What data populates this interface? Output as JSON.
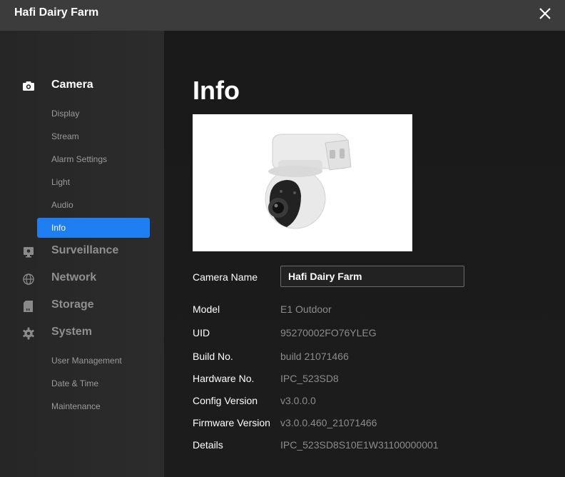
{
  "window": {
    "title": "Hafi Dairy Farm"
  },
  "sidebar": {
    "camera": {
      "label": "Camera",
      "items": [
        "Display",
        "Stream",
        "Alarm Settings",
        "Light",
        "Audio"
      ],
      "active": "Info"
    },
    "surveillance": {
      "label": "Surveillance"
    },
    "network": {
      "label": "Network"
    },
    "storage": {
      "label": "Storage"
    },
    "system": {
      "label": "System",
      "items": [
        "User Management",
        "Date & Time",
        "Maintenance"
      ]
    }
  },
  "main": {
    "title": "Info",
    "camera_name": {
      "label": "Camera Name",
      "value": "Hafi Dairy Farm"
    },
    "rows": [
      {
        "label": "Model",
        "value": "E1 Outdoor"
      },
      {
        "label": "UID",
        "value": "95270002FO76YLEG"
      },
      {
        "label": "Build No.",
        "value": "build 21071466"
      },
      {
        "label": "Hardware No.",
        "value": "IPC_523SD8"
      },
      {
        "label": "Config Version",
        "value": "v3.0.0.0"
      },
      {
        "label": "Firmware Version",
        "value": "v3.0.0.460_21071466"
      },
      {
        "label": "Details",
        "value": "IPC_523SD8S10E1W31100000001"
      }
    ]
  },
  "colors": {
    "accent": "#1e7ef2",
    "sidebar_bg": "#2a2a2a",
    "main_bg": "#1b1b1b",
    "titlebar_bg": "#3c3c3c"
  },
  "icons": [
    "close-icon",
    "camera-icon",
    "surveillance-icon",
    "network-icon",
    "storage-icon",
    "system-gear-icon"
  ]
}
